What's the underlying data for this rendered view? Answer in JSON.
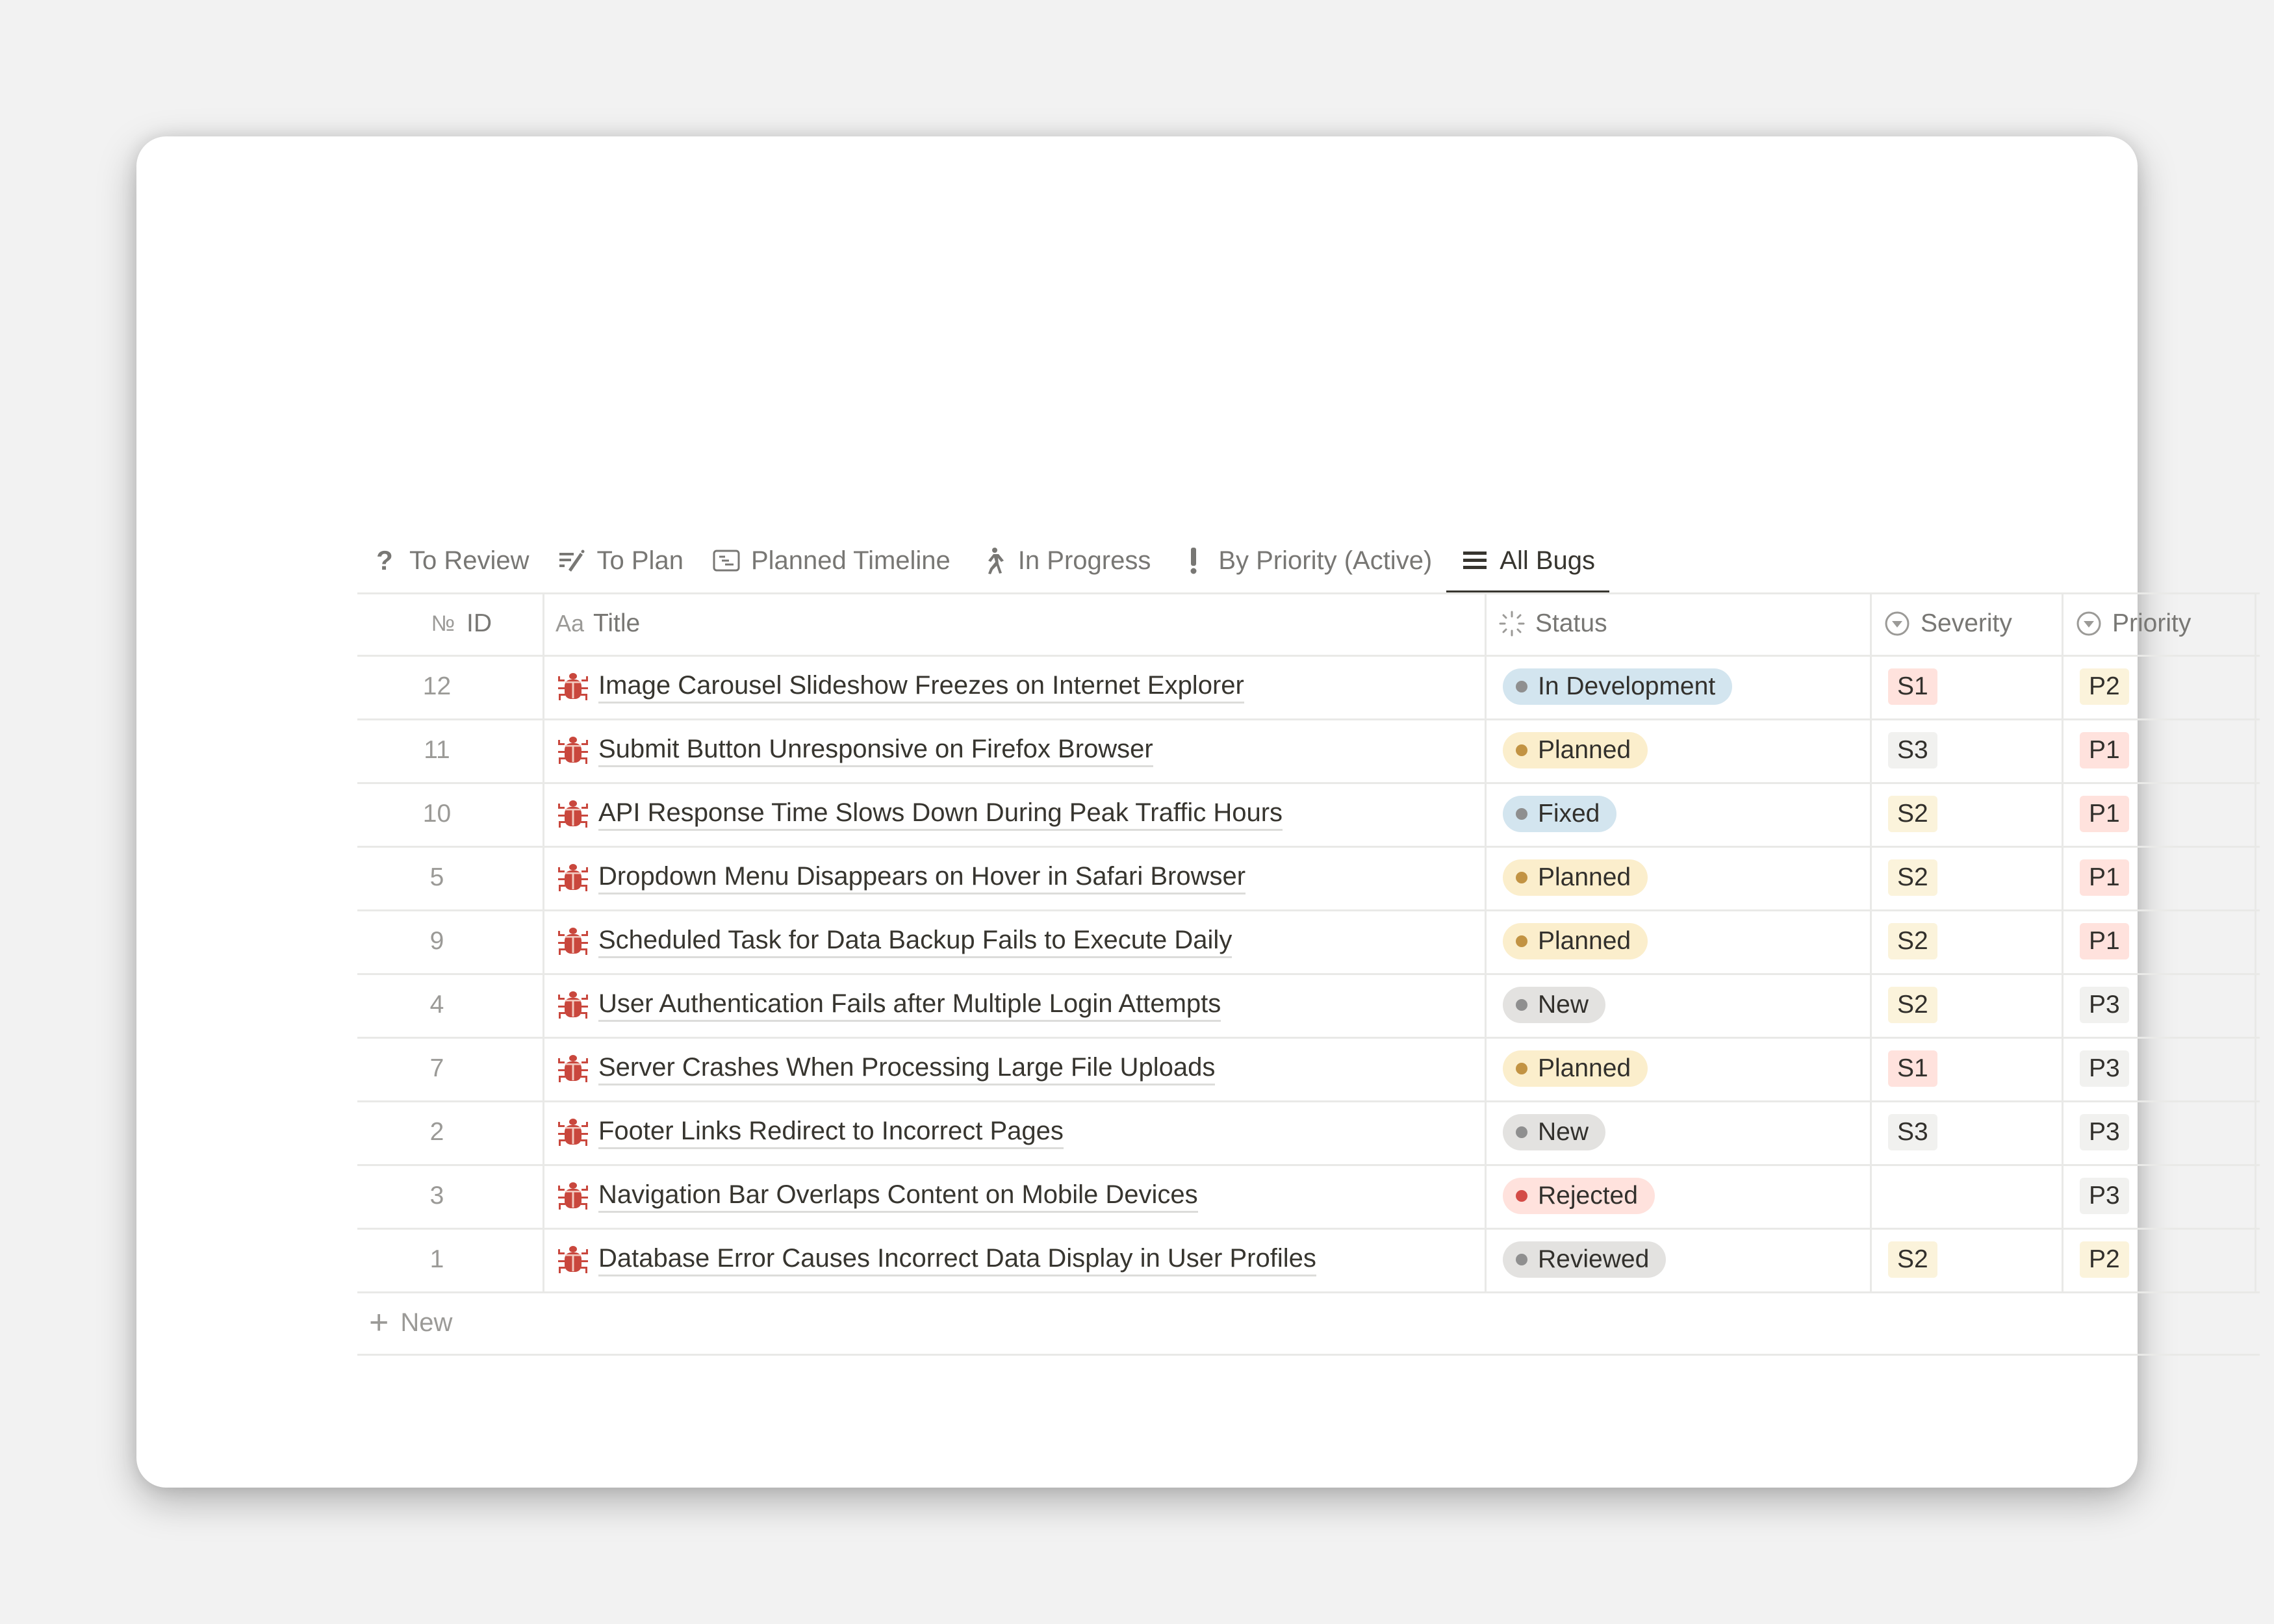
{
  "tabs": [
    {
      "label": "To Review",
      "icon": "question-mark-icon",
      "active": false
    },
    {
      "label": "To Plan",
      "icon": "list-edit-icon",
      "active": false
    },
    {
      "label": "Planned Timeline",
      "icon": "timeline-icon",
      "active": false
    },
    {
      "label": "In Progress",
      "icon": "running-person-icon",
      "active": false
    },
    {
      "label": "By Priority (Active)",
      "icon": "exclamation-icon",
      "active": false
    },
    {
      "label": "All Bugs",
      "icon": "list-icon",
      "active": true
    }
  ],
  "columns": {
    "id": {
      "label": "ID",
      "icon": "number-icon",
      "icon_text": "№"
    },
    "title": {
      "label": "Title",
      "icon": "text-icon",
      "icon_text": "Aa"
    },
    "status": {
      "label": "Status",
      "icon": "status-icon"
    },
    "severity": {
      "label": "Severity",
      "icon": "select-icon"
    },
    "priority": {
      "label": "Priority",
      "icon": "select-icon"
    }
  },
  "status_styles": {
    "In Development": {
      "bg": "#d3e5ef",
      "dot": "#8f8f8f"
    },
    "Planned": {
      "bg": "#fbeecc",
      "dot": "#c29343"
    },
    "Fixed": {
      "bg": "#d3e5ef",
      "dot": "#8f8f8f"
    },
    "New": {
      "bg": "#e3e2e0",
      "dot": "#8f8f8f"
    },
    "Rejected": {
      "bg": "#ffe2dd",
      "dot": "#d44c47"
    },
    "Reviewed": {
      "bg": "#e3e2e0",
      "dot": "#8f8f8f"
    }
  },
  "tag_styles": {
    "S1": "#ffe2dd",
    "S2": "#fbf3db",
    "S3": "#f1f1ef",
    "P1": "#ffe2dd",
    "P2": "#fbf3db",
    "P3": "#f1f1ef"
  },
  "rows": [
    {
      "id": "12",
      "title": "Image Carousel Slideshow Freezes on Internet Explorer",
      "status": "In Development",
      "severity": "S1",
      "priority": "P2"
    },
    {
      "id": "11",
      "title": "Submit Button Unresponsive on Firefox Browser",
      "status": "Planned",
      "severity": "S3",
      "priority": "P1"
    },
    {
      "id": "10",
      "title": "API Response Time Slows Down During Peak Traffic Hours",
      "status": "Fixed",
      "severity": "S2",
      "priority": "P1"
    },
    {
      "id": "5",
      "title": "Dropdown Menu Disappears on Hover in Safari Browser",
      "status": "Planned",
      "severity": "S2",
      "priority": "P1"
    },
    {
      "id": "9",
      "title": "Scheduled Task for Data Backup Fails to Execute Daily",
      "status": "Planned",
      "severity": "S2",
      "priority": "P1"
    },
    {
      "id": "4",
      "title": "User Authentication Fails after Multiple Login Attempts",
      "status": "New",
      "severity": "S2",
      "priority": "P3"
    },
    {
      "id": "7",
      "title": "Server Crashes When Processing Large File Uploads",
      "status": "Planned",
      "severity": "S1",
      "priority": "P3"
    },
    {
      "id": "2",
      "title": "Footer Links Redirect to Incorrect Pages",
      "status": "New",
      "severity": "S3",
      "priority": "P3"
    },
    {
      "id": "3",
      "title": "Navigation Bar Overlaps Content on Mobile Devices",
      "status": "Rejected",
      "severity": "",
      "priority": "P3"
    },
    {
      "id": "1",
      "title": "Database Error Causes Incorrect Data Display in User Profiles",
      "status": "Reviewed",
      "severity": "S2",
      "priority": "P2"
    }
  ],
  "row_icon": "bug-icon",
  "row_icon_color": "#c9473d",
  "new_row": {
    "label": "New",
    "icon": "plus-icon"
  }
}
